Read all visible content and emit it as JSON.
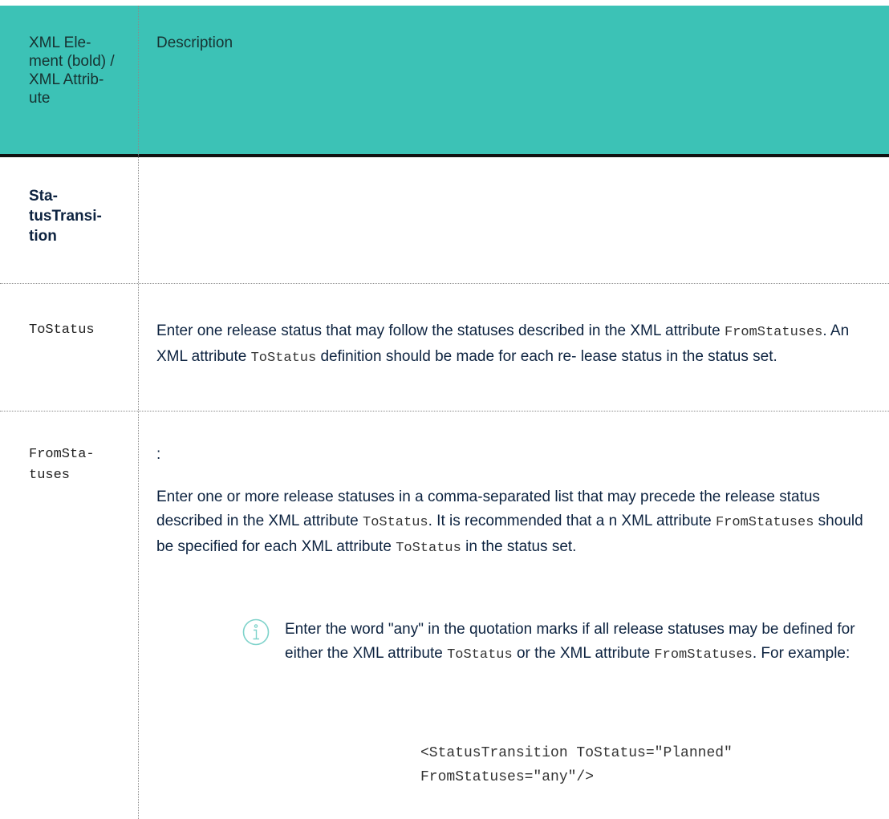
{
  "table": {
    "header": {
      "col1": "XML Ele- ment (bold) / XML Attrib- ute",
      "col2": "Description"
    },
    "rows": [
      {
        "name": "Sta- tusTransi- tion",
        "desc": ""
      },
      {
        "name": "ToStatus",
        "desc_parts": [
          "Enter one release status that may follow the statuses described in the XML attribute ",
          "FromStatuses",
          ". An XML attribute ",
          "ToStatus",
          " definition should be made for each re- lease status in the status set."
        ]
      },
      {
        "name": "FromSta- tuses",
        "colon": ":",
        "desc_parts": [
          "Enter one or more release statuses in a comma-separated list that may precede the release status described in the XML attribute ",
          "ToStatus",
          ". It is recommended that a n XML attribute ",
          "FromStatuses",
          " should be specified for each XML attribute ",
          "ToStatus",
          " in the status set."
        ],
        "note": {
          "icon": "info-icon",
          "text_parts": [
            "Enter the word \"any\" in the quotation marks if all release statuses may be defined for either the XML attribute ",
            "ToStatus",
            " or the XML attribute ",
            "FromStatuses",
            ". For example:"
          ]
        },
        "code": [
          "<StatusTransition ToStatus=\"Planned\"",
          "FromStatuses=\"any\"/>"
        ]
      }
    ]
  },
  "colors": {
    "header_bg": "#3cc2b6",
    "text": "#0d2340",
    "icon": "#7fd3cb"
  }
}
